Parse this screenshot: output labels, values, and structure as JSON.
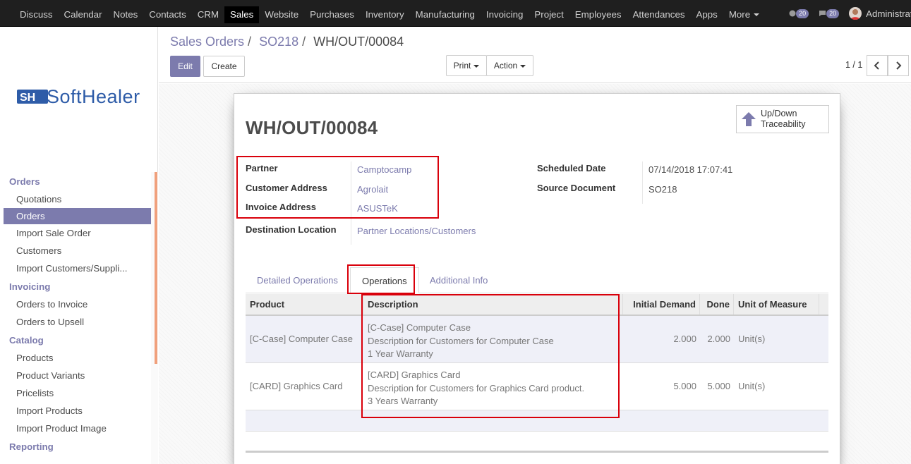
{
  "topnav": {
    "items": [
      "Discuss",
      "Calendar",
      "Notes",
      "Contacts",
      "CRM",
      "Sales",
      "Website",
      "Purchases",
      "Inventory",
      "Manufacturing",
      "Invoicing",
      "Project",
      "Employees",
      "Attendances",
      "Apps",
      "More"
    ],
    "active": "Sales",
    "activity_count": "20",
    "message_count": "20",
    "user": "Administrato"
  },
  "sidebar": {
    "logo_text": "SoftHealer",
    "sections": [
      {
        "title": "Orders",
        "items": [
          "Quotations",
          "Orders",
          "Import Sale Order",
          "Customers",
          "Import Customers/Suppli..."
        ]
      },
      {
        "title": "Invoicing",
        "items": [
          "Orders to Invoice",
          "Orders to Upsell"
        ]
      },
      {
        "title": "Catalog",
        "items": [
          "Products",
          "Product Variants",
          "Pricelists",
          "Import Products",
          "Import Product Image"
        ]
      },
      {
        "title": "Reporting",
        "items": []
      }
    ],
    "active_item": "Orders"
  },
  "control_panel": {
    "breadcrumb": [
      "Sales Orders",
      "SO218",
      "WH/OUT/00084"
    ],
    "edit_label": "Edit",
    "create_label": "Create",
    "print_label": "Print",
    "action_label": "Action",
    "pager": "1 / 1"
  },
  "form": {
    "title": "WH/OUT/00084",
    "trace_button_line1": "Up/Down",
    "trace_button_line2": "Traceability",
    "left_fields": [
      {
        "label": "Partner",
        "value": "Camptocamp"
      },
      {
        "label": "Customer Address",
        "value": "Agrolait"
      },
      {
        "label": "Invoice Address",
        "value": "ASUSTeK"
      },
      {
        "label": "Destination Location",
        "value": "Partner Locations/Customers"
      }
    ],
    "right_fields": [
      {
        "label": "Scheduled Date",
        "value": "07/14/2018 17:07:41"
      },
      {
        "label": "Source Document",
        "value": "SO218"
      }
    ],
    "tabs": [
      "Detailed Operations",
      "Operations",
      "Additional Info"
    ],
    "active_tab": "Operations",
    "table": {
      "headers": [
        "Product",
        "Description",
        "Initial Demand",
        "Done",
        "Unit of Measure"
      ],
      "rows": [
        {
          "product": "[C-Case] Computer Case",
          "description": [
            "[C-Case] Computer Case",
            "Description for Customers for Computer Case",
            "1 Year Warranty"
          ],
          "initial_demand": "2.000",
          "done": "2.000",
          "uom": "Unit(s)"
        },
        {
          "product": "[CARD] Graphics Card",
          "description": [
            "[CARD] Graphics Card",
            "Description for Customers for Graphics Card product.",
            "3 Years Warranty"
          ],
          "initial_demand": "5.000",
          "done": "5.000",
          "uom": "Unit(s)"
        }
      ]
    }
  },
  "colors": {
    "accent": "#7c7bad",
    "highlight_box": "#d9000b",
    "navbar": "#1f1f1f"
  }
}
